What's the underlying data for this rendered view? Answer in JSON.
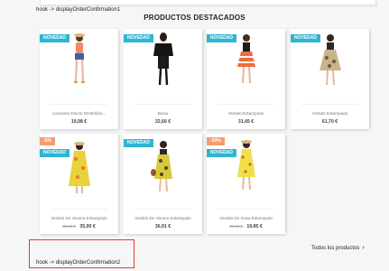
{
  "hooks": {
    "confirmation1": "hook -> displayOrderConfirmation1",
    "confirmation2": "hook -> displayOrderConfirmation2"
  },
  "section": {
    "title": "PRODUCTOS DESTACADOS"
  },
  "products": [
    {
      "name": "Camiseta Efecto Desteñido...",
      "price": "19,98 €",
      "old_price": "",
      "badges": [
        "NOVEDAD"
      ]
    },
    {
      "name": "Blusa",
      "price": "32,66 €",
      "old_price": "",
      "badges": [
        "NOVEDAD"
      ]
    },
    {
      "name": "Vestido Estampado",
      "price": "31,45 €",
      "old_price": "",
      "badges": [
        "NOVEDAD"
      ]
    },
    {
      "name": "Vestido Estampado",
      "price": "61,70 €",
      "old_price": "",
      "badges": [
        "NOVEDAD"
      ]
    },
    {
      "name": "Vestido De Verano Estampado",
      "price": "35,00 €",
      "old_price": "36,61 €",
      "badges": [
        "-5%",
        "NOVEDAD"
      ]
    },
    {
      "name": "Vestido De Verano Estampado",
      "price": "36,91 €",
      "old_price": "",
      "badges": [
        "NOVEDAD"
      ]
    },
    {
      "name": "Vestido De Gasa Estampado",
      "price": "19,85 €",
      "old_price": "24,81 €",
      "badges": [
        "-20%",
        "NOVEDAD"
      ]
    }
  ],
  "all_products_link": {
    "label": "Todos los productos",
    "icon": "chevron-right-icon"
  },
  "colors": {
    "badge_new": "#2fb5d2",
    "badge_discount": "#f39d72",
    "highlight_box": "#e23a3a"
  }
}
